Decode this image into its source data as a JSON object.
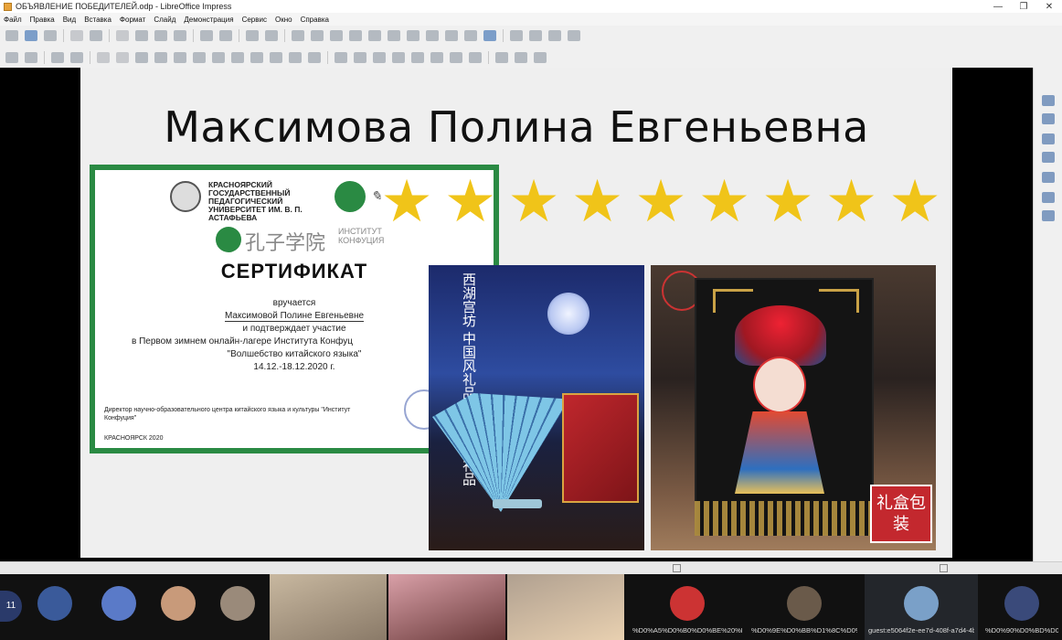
{
  "window": {
    "title": "ОБЪЯВЛЕНИЕ ПОБЕДИТЕЛЕЙ.odp - LibreOffice Impress",
    "minimize": "—",
    "restore": "❐",
    "close": "✕"
  },
  "menu": [
    "Файл",
    "Правка",
    "Вид",
    "Вставка",
    "Формат",
    "Слайд",
    "Демонстрация",
    "Сервис",
    "Окно",
    "Справка"
  ],
  "slide": {
    "title": "Максимова Полина Евгеньевна",
    "star_count": 9,
    "star_color": "#f0c419",
    "certificate": {
      "university": "КРАСНОЯРСКИЙ ГОСУДАРСТВЕННЫЙ ПЕДАГОГИЧЕСКИЙ УНИВЕРСИТЕТ ИМ. В. П. АСТАФЬЕВА",
      "institute_cn": "孔子学院",
      "institute_ru": "ИНСТИТУТ КОНФУЦИЯ",
      "title": "СЕРТИФИКАТ",
      "line1": "вручается",
      "line2": "Максимовой Полине Евгеньевне",
      "line3": "и подтверждает участие",
      "line4": "в Первом зимнем онлайн-лагере Института Конфуц",
      "line5": "\"Волшебство китайского языка\"",
      "line6": "14.12.-18.12.2020 г.",
      "director": "Директор научно-образовательного центра китайского языка и культуры \"Институт Конфуция\"",
      "city": "КРАСНОЯРСК 2020",
      "border_color": "#2a8a43"
    },
    "photo_fan": {
      "vertical_text": "西湖宫坊 中国风礼品 云锦办公礼品"
    },
    "photo_opera": {
      "gift_label": "礼盒包装"
    }
  },
  "participants": {
    "count": "11",
    "tiles": [
      {
        "label": ""
      },
      {
        "label": ""
      },
      {
        "label": ""
      },
      {
        "label": ""
      },
      {
        "label": ""
      },
      {
        "label": ""
      },
      {
        "label": ""
      },
      {
        "label": "%D0%A5%D0%B0%D0%BE%20%D..."
      },
      {
        "label": "%D0%9E%D0%BB%D1%8C%D0%B..."
      },
      {
        "label": "guest:e5064f2e-ee7d-408f-a7d4-4b..."
      },
      {
        "label": "%D0%90%D0%BD%D0%..."
      }
    ]
  }
}
